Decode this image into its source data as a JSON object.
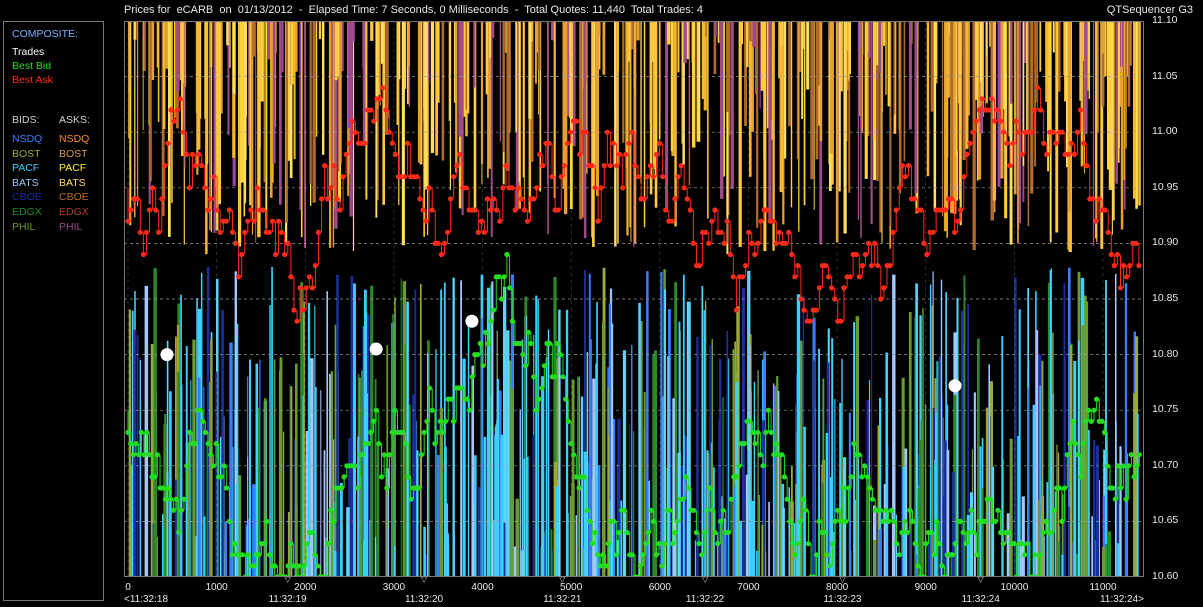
{
  "header": {
    "title": "Prices for  eCARB  on  01/13/2012  -  Elapsed Time: 7 Seconds, 0 Milliseconds  -  Total Quotes: 11,440  Total Trades: 4",
    "app": "QTSequencer G3"
  },
  "legend": {
    "composite_label": "COMPOSITE:",
    "composite": [
      {
        "label": "Trades",
        "color": "#ffffff"
      },
      {
        "label": "Best Bid",
        "color": "#22dd22"
      },
      {
        "label": "Best Ask",
        "color": "#ff2a1a"
      }
    ],
    "bids_label": "BIDS:",
    "asks_label": "ASKS:",
    "exchanges": [
      {
        "bid": "NSDQ",
        "bid_color": "#3b7dff",
        "ask": "NSDQ",
        "ask_color": "#ff8a2a"
      },
      {
        "bid": "BOST",
        "bid_color": "#9aaa3a",
        "ask": "BOST",
        "ask_color": "#d89a50"
      },
      {
        "bid": "PACF",
        "bid_color": "#3ad0ff",
        "ask": "PACF",
        "ask_color": "#ffee30"
      },
      {
        "bid": "BATS",
        "bid_color": "#a0c8ff",
        "ask": "BATS",
        "ask_color": "#ffd860"
      },
      {
        "bid": "CBOE",
        "bid_color": "#1a2f9a",
        "ask": "CBOE",
        "ask_color": "#c07028"
      },
      {
        "bid": "EDGX",
        "bid_color": "#2a8a2a",
        "ask": "EDGX",
        "ask_color": "#b03a2a"
      },
      {
        "bid": "PHIL",
        "bid_color": "#6a9a30",
        "ask": "PHIL",
        "ask_color": "#a04a8a"
      }
    ]
  },
  "chart_data": {
    "type": "scatter",
    "xlabel": "",
    "ylabel": "",
    "xlim": [
      0,
      11440
    ],
    "ylim": [
      10.6,
      11.1
    ],
    "x_ticks": [
      0,
      1000,
      2000,
      3000,
      4000,
      5000,
      6000,
      7000,
      8000,
      9000,
      10000,
      11000
    ],
    "y_ticks": [
      "10.60",
      "10.65",
      "10.70",
      "10.75",
      "10.80",
      "10.85",
      "10.90",
      "10.95",
      "11.00",
      "11.05",
      "11.10"
    ],
    "time_ticks": [
      {
        "x": 0,
        "label": "<11:32:18"
      },
      {
        "x": 1800,
        "label": "11:32:19"
      },
      {
        "x": 3340,
        "label": "11:32:20"
      },
      {
        "x": 4900,
        "label": "11:32:21"
      },
      {
        "x": 6510,
        "label": "11:32:22"
      },
      {
        "x": 8060,
        "label": "11:32:23"
      },
      {
        "x": 9620,
        "label": "11:32:24"
      },
      {
        "x": 11440,
        "label": "11:32:24>"
      }
    ],
    "grid": true,
    "trades": [
      {
        "x": 440,
        "y": 10.8
      },
      {
        "x": 2800,
        "y": 10.805
      },
      {
        "x": 3880,
        "y": 10.83
      },
      {
        "x": 9330,
        "y": 10.772
      }
    ],
    "best_bid_range": [
      10.6,
      10.91
    ],
    "best_ask_range": [
      10.83,
      11.06
    ],
    "series": [
      {
        "name": "Trades",
        "color": "#ffffff"
      },
      {
        "name": "Best Bid",
        "color": "#22dd22"
      },
      {
        "name": "Best Ask",
        "color": "#ff2a1a"
      }
    ]
  }
}
